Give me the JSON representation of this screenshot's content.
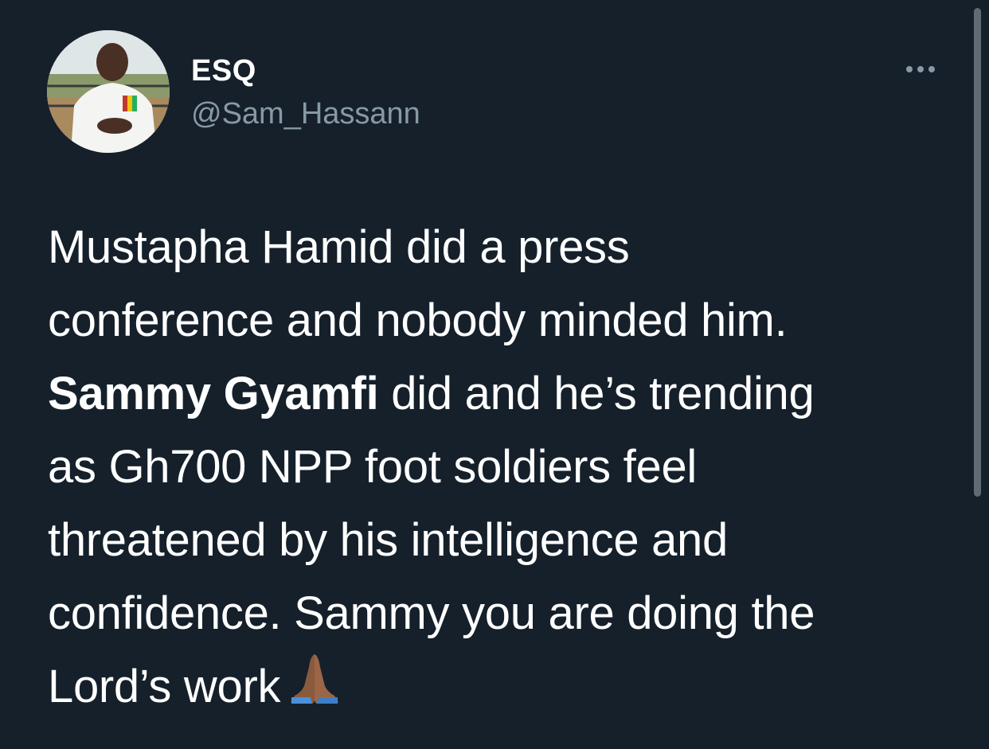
{
  "author": {
    "display_name": "ESQ",
    "handle": "@Sam_Hassann"
  },
  "menu": {
    "icon": "more-horizontal-icon"
  },
  "tweet": {
    "line1": "Mustapha Hamid did a press",
    "line2": "conference and nobody minded him.",
    "line3_bold": "Sammy Gyamfi",
    "line3_rest": " did and he’s trending",
    "line4": "as Gh700 NPP foot soldiers feel",
    "line5": "threatened by his intelligence and",
    "line6": "confidence. Sammy you are doing the",
    "line7": "Lord’s work",
    "emoji": "folded-hands-emoji"
  },
  "colors": {
    "background": "#15202b",
    "text": "#ffffff",
    "secondary_text": "#8899a6"
  }
}
